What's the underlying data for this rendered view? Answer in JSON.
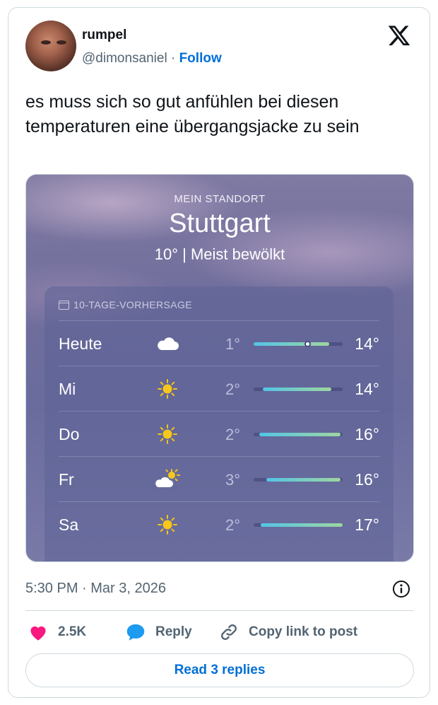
{
  "user": {
    "display_name": "rumpel",
    "handle": "@dimonsaniel",
    "separator": "·",
    "follow_label": "Follow"
  },
  "tweet": {
    "text": "es muss sich so gut anfühlen bei diesen temperaturen eine übergangsjacke zu sein",
    "timestamp": "5:30 PM · Mar 3, 2026"
  },
  "weather": {
    "location_label": "MEIN STANDORT",
    "city": "Stuttgart",
    "current": "10°  |  Meist bewölkt",
    "forecast_header": "10-TAGE-VORHERSAGE",
    "days": [
      {
        "day": "Heute",
        "icon": "cloud-icon",
        "low": "1°",
        "high": "14°",
        "bar_start": 0.0,
        "bar_end": 0.85,
        "current_marker": 0.6
      },
      {
        "day": "Mi",
        "icon": "sun-icon",
        "low": "2°",
        "high": "14°",
        "bar_start": 0.1,
        "bar_end": 0.87
      },
      {
        "day": "Do",
        "icon": "sun-icon",
        "low": "2°",
        "high": "16°",
        "bar_start": 0.06,
        "bar_end": 0.98
      },
      {
        "day": "Fr",
        "icon": "sun-cloud-icon",
        "low": "3°",
        "high": "16°",
        "bar_start": 0.14,
        "bar_end": 0.98
      },
      {
        "day": "Sa",
        "icon": "sun-icon",
        "low": "2°",
        "high": "17°",
        "bar_start": 0.08,
        "bar_end": 1.0
      }
    ]
  },
  "actions": {
    "like_count": "2.5K",
    "reply_label": "Reply",
    "copy_label": "Copy link to post",
    "read_replies_label": "Read 3 replies"
  },
  "colors": {
    "accent": "#006fd6",
    "like": "#f91880",
    "reply_bubble": "#1d9bf0",
    "muted": "#536471"
  }
}
